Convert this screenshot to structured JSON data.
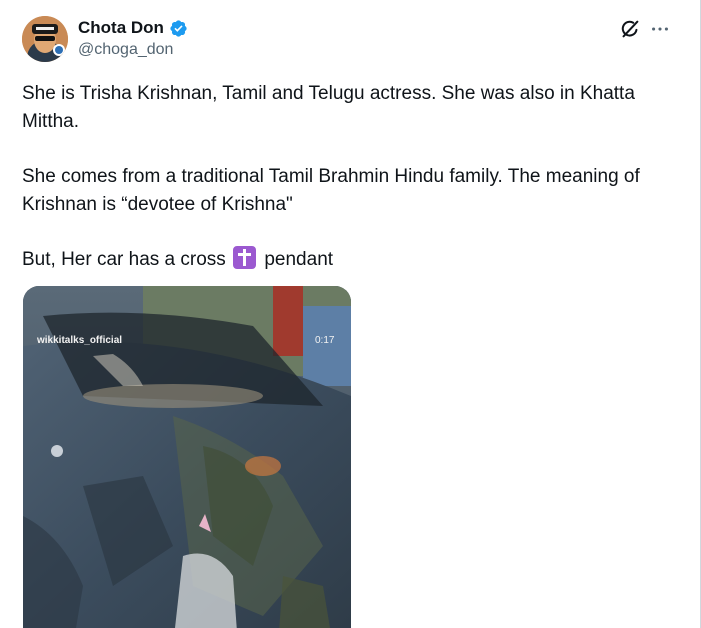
{
  "post": {
    "author": {
      "display_name": "Chota Don",
      "handle": "@choga_don",
      "verified": true,
      "verified_color": "#1d9bf0"
    },
    "icons": {
      "avatar": "avatar",
      "verified": "verified-badge-icon",
      "grok": "grok-icon",
      "more": "more-icon"
    },
    "text": {
      "para1": "She is Trisha Krishnan, Tamil and Telugu actress. She was also in Khatta Mittha.",
      "para2": "She comes from a traditional Tamil Brahmin Hindu family. The meaning of Krishnan is “devotee of Krishna\"",
      "para3_before": "But, Her car has a cross",
      "para3_emoji": "latin-cross-emoji",
      "para3_after": "pendant"
    },
    "media": {
      "type": "video",
      "watermark": "wikkitalks_official",
      "duration": "0:17"
    }
  },
  "colors": {
    "text_primary": "#0f1419",
    "text_secondary": "#536471",
    "accent": "#1d9bf0",
    "cross_emoji_bg": "#9b59d0"
  }
}
